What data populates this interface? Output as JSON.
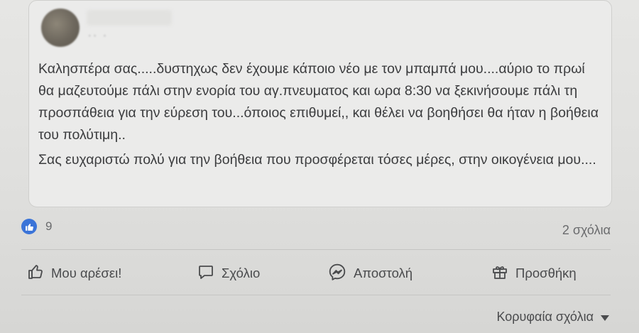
{
  "post": {
    "author_meta": "·· ·",
    "paragraphs": [
      "Καλησπέρα σας.....δυστηχως δεν έχουμε κάποιο νέο με τον μπαμπά μου....αύριο το πρωί  θα μαζευτούμε  πάλι στην ενορία του αγ.πνευματος  και ωρα 8:30 να ξεκινήσουμε πάλι τη προσπάθεια  για την εύρεση του...όποιος επιθυμεί,, και θέλει να βοηθήσει θα ήταν η βοήθεια  του πολύτιμη..",
      "Σας ευχαριστώ πολύ για την βοήθεια  που προσφέρεται  τόσες μέρες, στην οικογένεια μου...."
    ]
  },
  "reactions": {
    "icon": "like-icon",
    "count": "9",
    "color": "#3b74d8"
  },
  "comments": {
    "count_label": "2 σχόλια"
  },
  "actions": {
    "like_label": "Μου αρέσει!",
    "comment_label": "Σχόλιο",
    "send_label": "Αποστολή",
    "gift_label": "Προσθήκη"
  },
  "sort": {
    "label": "Κορυφαία σχόλια",
    "icon": "caret-down-icon"
  }
}
